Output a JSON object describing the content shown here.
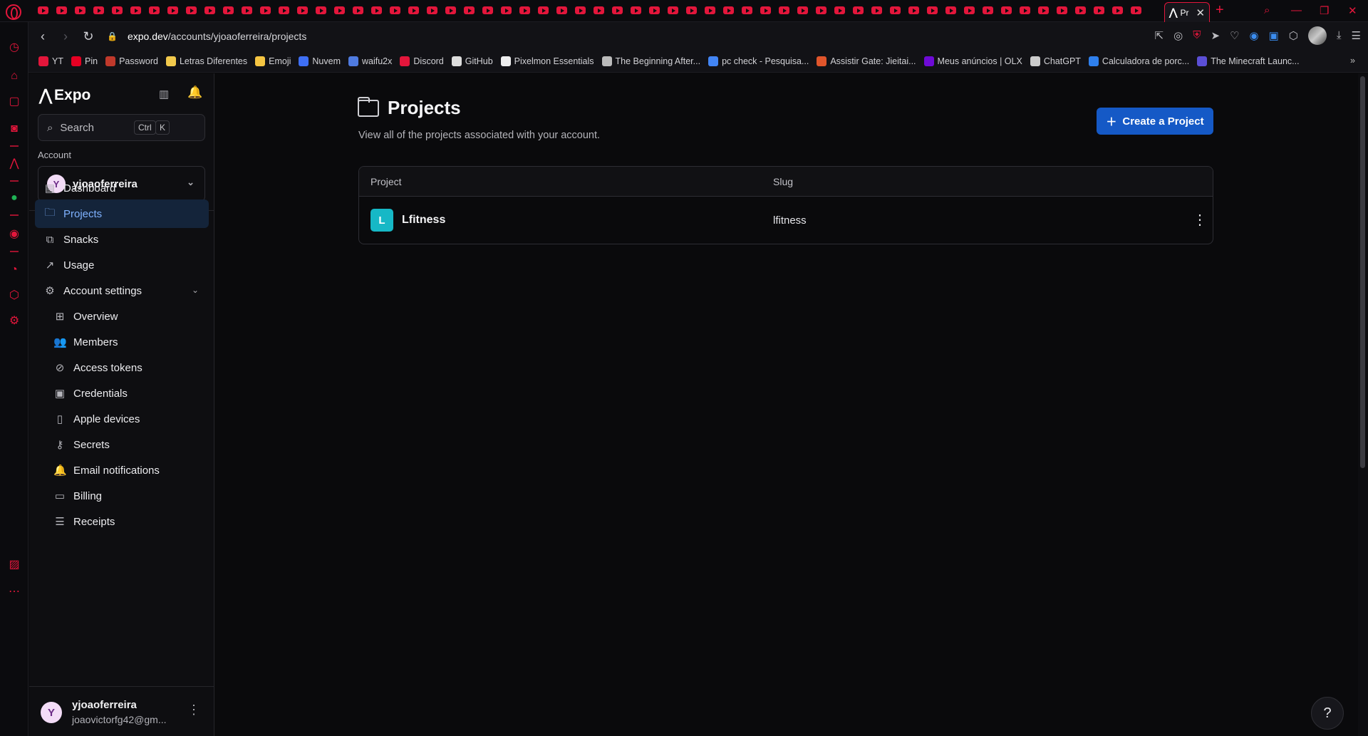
{
  "browser": {
    "mini_tab_count": 60,
    "active_tab": {
      "favicon": "expo-icon",
      "title": "Pr",
      "close": "✕"
    },
    "new_tab": "+",
    "url_host": "expo.dev",
    "url_path": "/accounts/yjoaoferreira/projects",
    "bookmarks": [
      {
        "label": "YT",
        "color": "#e3163b"
      },
      {
        "label": "Pin",
        "color": "#e60023"
      },
      {
        "label": "Password",
        "color": "#c0392b"
      },
      {
        "label": "Letras Diferentes",
        "color": "#f2c94c"
      },
      {
        "label": "Emoji",
        "color": "#f5c542"
      },
      {
        "label": "Nuvem",
        "color": "#3e6ff4"
      },
      {
        "label": "waifu2x",
        "color": "#4f7be0"
      },
      {
        "label": "Discord",
        "color": "#e3163b"
      },
      {
        "label": "GitHub",
        "color": "#dddddd"
      },
      {
        "label": "Pixelmon Essentials",
        "color": "#eeeeee"
      },
      {
        "label": "The Beginning After...",
        "color": "#bbbbbb"
      },
      {
        "label": "pc check - Pesquisa...",
        "color": "#4285f4"
      },
      {
        "label": "Assistir Gate: Jieitai...",
        "color": "#e0552b"
      },
      {
        "label": "Meus anúncios | OLX",
        "color": "#6e0ad6"
      },
      {
        "label": "ChatGPT",
        "color": "#cccccc"
      },
      {
        "label": "Calculadora de porc...",
        "color": "#2f80ed"
      },
      {
        "label": "The Minecraft Launc...",
        "color": "#5b4fd6"
      }
    ]
  },
  "sidebar": {
    "brand": "Expo",
    "search": {
      "placeholder": "Search",
      "key1": "Ctrl",
      "key2": "K"
    },
    "account_label": "Account",
    "account": {
      "initial": "Y",
      "name": "yjoaoferreira"
    },
    "nav": [
      {
        "label": "Dashboard",
        "icon": "dashboard-icon",
        "glyph": "▤"
      },
      {
        "label": "Projects",
        "icon": "folder-icon",
        "glyph": "🗀",
        "active": true
      },
      {
        "label": "Snacks",
        "icon": "snack-icon",
        "glyph": "⧉"
      },
      {
        "label": "Usage",
        "icon": "chart-icon",
        "glyph": "↗"
      },
      {
        "label": "Account settings",
        "icon": "gear-icon",
        "glyph": "⚙"
      }
    ],
    "settings_items": [
      {
        "label": "Overview",
        "icon": "grid-icon",
        "glyph": "⊞"
      },
      {
        "label": "Members",
        "icon": "members-icon",
        "glyph": "👥"
      },
      {
        "label": "Access tokens",
        "icon": "link-icon",
        "glyph": "⊘"
      },
      {
        "label": "Credentials",
        "icon": "credentials-icon",
        "glyph": "▣"
      },
      {
        "label": "Apple devices",
        "icon": "device-icon",
        "glyph": "▯"
      },
      {
        "label": "Secrets",
        "icon": "key-icon",
        "glyph": "⚷"
      },
      {
        "label": "Email notifications",
        "icon": "bell-icon",
        "glyph": "🔔"
      },
      {
        "label": "Billing",
        "icon": "card-icon",
        "glyph": "▭"
      },
      {
        "label": "Receipts",
        "icon": "receipt-icon",
        "glyph": "☰"
      }
    ],
    "footer": {
      "initial": "Y",
      "name": "yjoaoferreira",
      "email": "joaovictorfg42@gm..."
    }
  },
  "main": {
    "title": "Projects",
    "subtitle": "View all of the projects associated with your account.",
    "create_button": "Create a Project",
    "table": {
      "headers": [
        "Project",
        "Slug"
      ],
      "rows": [
        {
          "initial": "L",
          "name": "Lfitness",
          "slug": "lfitness"
        }
      ]
    }
  },
  "help_label": "?"
}
